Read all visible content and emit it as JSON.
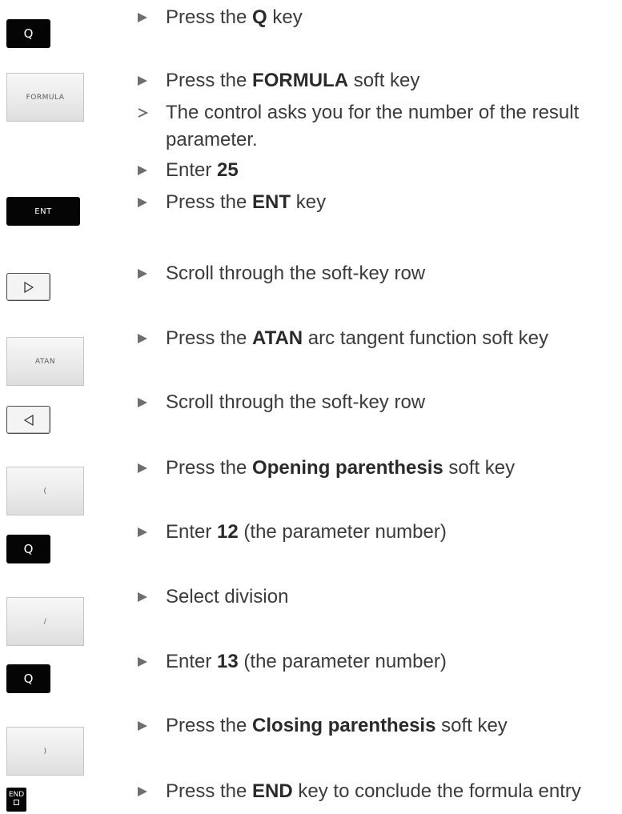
{
  "keys": {
    "q1": "Q",
    "formula": "FORMULA",
    "ent": "ENT",
    "atan": "ATAN",
    "open_paren": "(",
    "q2": "Q",
    "divide": "/",
    "q3": "Q",
    "close_paren": ")",
    "end": "END"
  },
  "steps": [
    {
      "pre": "Press the ",
      "bold": "Q",
      "post": " key"
    },
    {
      "pre": "Press the ",
      "bold": "FORMULA",
      "post": " soft key"
    },
    {
      "line1": "The control asks you for the number of the result",
      "line2": "parameter."
    },
    {
      "pre": "Enter ",
      "bold": "25",
      "post": ""
    },
    {
      "pre": "Press the ",
      "bold": "ENT",
      "post": " key"
    },
    {
      "pre": "Scroll through the soft-key row",
      "bold": "",
      "post": ""
    },
    {
      "pre": "Press the ",
      "bold": "ATAN",
      "post": " arc tangent function soft key"
    },
    {
      "pre": "Scroll through the soft-key row",
      "bold": "",
      "post": ""
    },
    {
      "pre": "Press the ",
      "bold": "Opening parenthesis",
      "post": " soft key"
    },
    {
      "pre": "Enter ",
      "bold": "12",
      "post": " (the parameter number)"
    },
    {
      "pre": "Select division",
      "bold": "",
      "post": ""
    },
    {
      "pre": "Enter ",
      "bold": "13",
      "post": " (the parameter number)"
    },
    {
      "pre": "Press the ",
      "bold": "Closing parenthesis",
      "post": " soft key"
    },
    {
      "pre": "Press the ",
      "bold": "END",
      "post": " key to conclude the formula entry"
    }
  ],
  "icons": {
    "bullet": "triangle-right-icon",
    "result": "chevron-right-icon",
    "scroll_right": "triangle-right-outline-icon",
    "scroll_left": "triangle-left-outline-icon"
  },
  "colors": {
    "text": "#3b3b3b",
    "bullet": "#6e6e6e",
    "hard_key": "#050505",
    "soft_key": "#ececec"
  }
}
